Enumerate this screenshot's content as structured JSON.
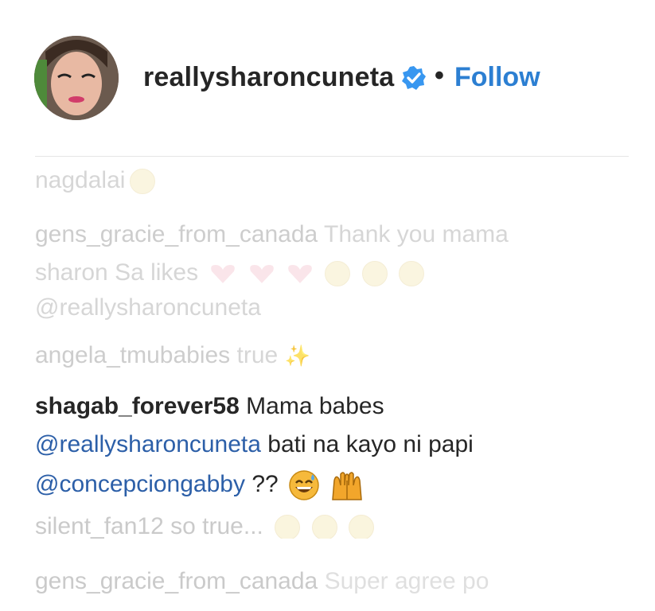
{
  "header": {
    "username": "reallysharoncuneta",
    "separator": "•",
    "follow_label": "Follow",
    "verified_icon": "verified-badge-icon",
    "accent_color": "#2c7fd2"
  },
  "comments_faded_top": [
    {
      "text": "nagdalai"
    },
    {
      "user": "gens_gracie_from_canada",
      "text": "Thank you mama"
    },
    {
      "text": "sharon Sa likes"
    },
    {
      "text": "@reallysharoncuneta"
    },
    {
      "user": "angela_tmubabies",
      "text": "true"
    }
  ],
  "main_comment": {
    "user": "shagab_forever58",
    "line1_text": "Mama babes",
    "mention1": "@reallysharoncuneta",
    "line2_text": "bati na kayo ni papi",
    "mention2": "@concepciongabby",
    "line3_text": "??"
  },
  "comments_faded_bottom": [
    {
      "user": "silent_fan12",
      "text": "so true..."
    },
    {
      "user": "gens_gracie_from_canada",
      "text": "Super agree po"
    }
  ]
}
